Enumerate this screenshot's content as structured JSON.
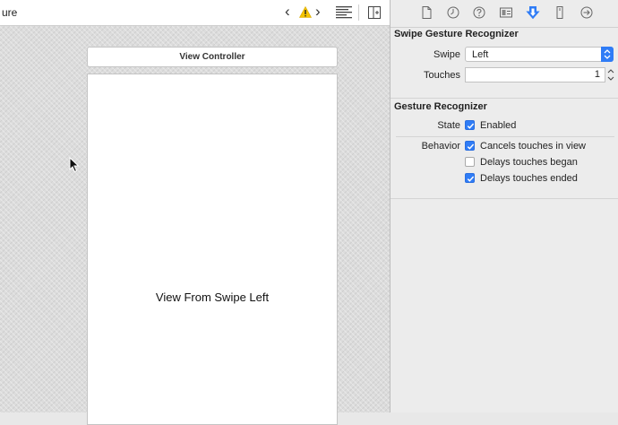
{
  "editor": {
    "tab_title": "ure",
    "nav_back": "‹",
    "nav_forward": "›",
    "icons": [
      "warning-icon",
      "lines-icon",
      "assistant-editor-icon"
    ]
  },
  "canvas": {
    "view_controller_label": "View Controller",
    "scene_label": "View From Swipe Left"
  },
  "inspector": {
    "tabs": [
      "file-icon",
      "history-icon",
      "help-icon",
      "identity-icon",
      "attributes-icon",
      "size-icon",
      "connections-icon"
    ],
    "active_tab": "attributes-icon",
    "swipe_section": {
      "title": "Swipe Gesture Recognizer",
      "swipe_label": "Swipe",
      "swipe_value": "Left",
      "touches_label": "Touches",
      "touches_value": "1"
    },
    "gesture_section": {
      "title": "Gesture Recognizer",
      "state_label": "State",
      "state_option": "Enabled",
      "state_checked": true,
      "behavior_label": "Behavior",
      "behavior_options": [
        {
          "label": "Cancels touches in view",
          "checked": true
        },
        {
          "label": "Delays touches began",
          "checked": false
        },
        {
          "label": "Delays touches ended",
          "checked": true
        }
      ]
    },
    "accent_color": "#2f7cf6"
  }
}
